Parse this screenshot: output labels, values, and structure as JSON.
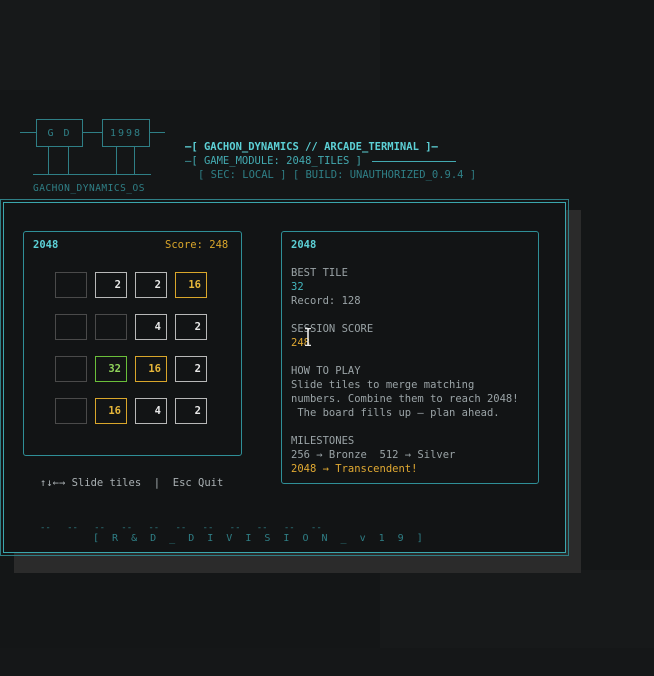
{
  "header": {
    "logo_left": "G D",
    "logo_right": "1998",
    "logo_caption": "GACHON_DYNAMICS_OS",
    "title_line": "—[ GACHON_DYNAMICS // ARCADE_TERMINAL ]—",
    "module_line": "—[ GAME_MODULE: 2048_TILES ]",
    "sec_line": "[ SEC: LOCAL ] [ BUILD: UNAUTHORIZED_0.9.4 ]"
  },
  "game": {
    "title": "2048",
    "score_text": "Score: 248",
    "board": [
      [
        "",
        "2",
        "2",
        "16"
      ],
      [
        "",
        "",
        "4",
        "2"
      ],
      [
        "",
        "32",
        "16",
        "2"
      ],
      [
        "",
        "16",
        "4",
        "2"
      ]
    ],
    "controls": "↑↓←→ Slide tiles  |  Esc Quit"
  },
  "info": {
    "title": "2048",
    "best_label": "BEST TILE",
    "best_value": "32",
    "record": "Record: 128",
    "session_label": "SESSION SCORE",
    "session_value": "248",
    "howto_label": "HOW TO PLAY",
    "howto_line1": "Slide tiles to merge matching",
    "howto_line2": "numbers. Combine them to reach 2048!",
    "howto_line3": " The board fills up — plan ahead.",
    "milestones_label": "MILESTONES",
    "milestones_line1": "256 → Bronze  512 → Silver",
    "milestones_line2": "2048 → Transcendent!"
  },
  "footer": {
    "dashes": "--   --   --   --   --   --   --   --   --   --   --",
    "division": "[ R & D _ D I V I S I O N _ v 1 9 ]"
  },
  "colors": {
    "accent": "#43b7bf",
    "gold": "#e0a932",
    "green": "#8fd35a"
  }
}
